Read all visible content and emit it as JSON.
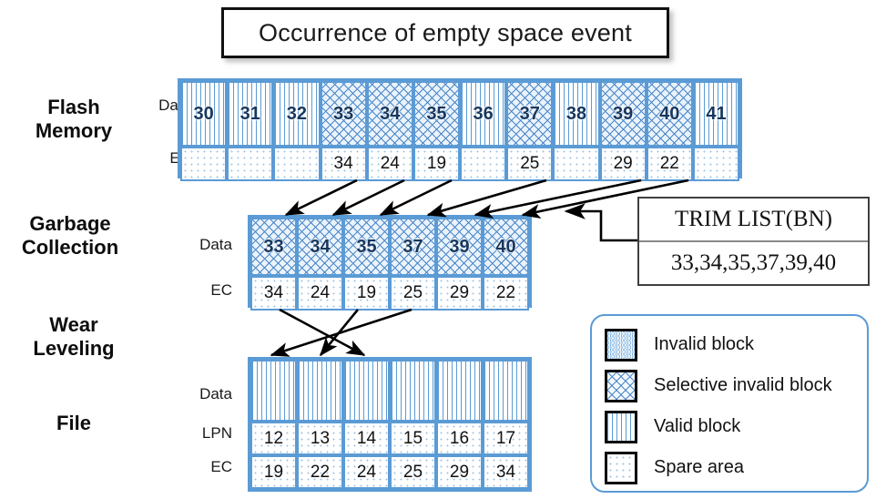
{
  "title": {
    "text": "Occurrence of empty space event"
  },
  "stages": [
    {
      "name": "flash-memory",
      "label": "Flash\nMemory"
    },
    {
      "name": "garbage-collection",
      "label": "Garbage\nCollection"
    },
    {
      "name": "wear-leveling",
      "label": "Wear\nLeveling"
    },
    {
      "name": "file",
      "label": "File"
    }
  ],
  "row_labels": {
    "flash_data": "Data",
    "flash_ec": "EC",
    "gc_data": "Data",
    "gc_ec": "EC",
    "file_data": "Data",
    "file_lpn": "LPN",
    "file_ec": "EC"
  },
  "flash_memory": {
    "data": [
      {
        "bn": "30",
        "pattern": "valid"
      },
      {
        "bn": "31",
        "pattern": "valid"
      },
      {
        "bn": "32",
        "pattern": "valid"
      },
      {
        "bn": "33",
        "pattern": "selective"
      },
      {
        "bn": "34",
        "pattern": "selective"
      },
      {
        "bn": "35",
        "pattern": "selective"
      },
      {
        "bn": "36",
        "pattern": "valid"
      },
      {
        "bn": "37",
        "pattern": "selective"
      },
      {
        "bn": "38",
        "pattern": "valid"
      },
      {
        "bn": "39",
        "pattern": "selective"
      },
      {
        "bn": "40",
        "pattern": "selective"
      },
      {
        "bn": "41",
        "pattern": "valid"
      }
    ],
    "ec": [
      "",
      "",
      "",
      "34",
      "24",
      "19",
      "",
      "25",
      "",
      "29",
      "22",
      ""
    ]
  },
  "garbage_collection": {
    "data": [
      {
        "bn": "33",
        "pattern": "selective"
      },
      {
        "bn": "34",
        "pattern": "selective"
      },
      {
        "bn": "35",
        "pattern": "selective"
      },
      {
        "bn": "37",
        "pattern": "selective"
      },
      {
        "bn": "39",
        "pattern": "selective"
      },
      {
        "bn": "40",
        "pattern": "selective"
      }
    ],
    "ec": [
      "34",
      "24",
      "19",
      "25",
      "29",
      "22"
    ]
  },
  "file": {
    "data": [
      {
        "bn": "",
        "pattern": "valid"
      },
      {
        "bn": "",
        "pattern": "valid"
      },
      {
        "bn": "",
        "pattern": "valid"
      },
      {
        "bn": "",
        "pattern": "valid"
      },
      {
        "bn": "",
        "pattern": "valid"
      },
      {
        "bn": "",
        "pattern": "valid"
      }
    ],
    "lpn": [
      "12",
      "13",
      "14",
      "15",
      "16",
      "17"
    ],
    "ec": [
      "19",
      "22",
      "24",
      "25",
      "29",
      "34"
    ]
  },
  "trim_list": {
    "header": "TRIM LIST(BN)",
    "values": "33,34,35,37,39,40"
  },
  "legend": {
    "items": [
      {
        "swatch": "invalid",
        "label": "Invalid block"
      },
      {
        "swatch": "selective",
        "label": "Selective invalid block"
      },
      {
        "swatch": "valid",
        "label": "Valid block"
      },
      {
        "swatch": "spare",
        "label": "Spare area"
      }
    ]
  },
  "colors": {
    "block_border": "#5B9BD5",
    "block_number": "#17375E",
    "arrow": "#000000",
    "legend_border": "#5B9BD5",
    "title_border": "#111111"
  }
}
